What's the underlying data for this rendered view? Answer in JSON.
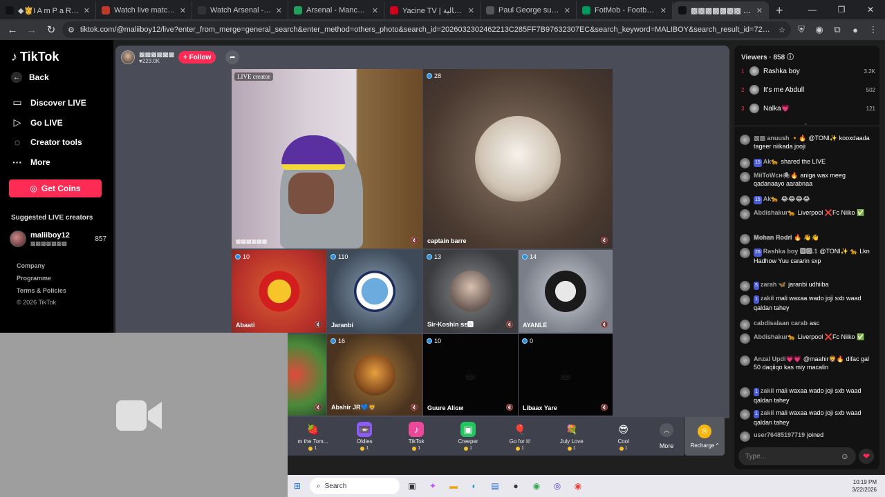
{
  "browser": {
    "tabs": [
      {
        "title": "◆👸I A m P a R D 💗🍓",
        "color": "#111111"
      },
      {
        "title": "Watch live matches — Ya",
        "color": "#c0392b"
      },
      {
        "title": "Watch Arsenal - Manches",
        "color": "#333333"
      },
      {
        "title": "Arsenal - Manchester City",
        "color": "#20a05a"
      },
      {
        "title": "Yacine TV | يقوم بجودة عالية",
        "color": "#d0021b"
      },
      {
        "title": "Paul George suspended fo",
        "color": "#555555"
      },
      {
        "title": "FotMob - Football Live Sc",
        "color": "#00985f"
      },
      {
        "title": "▩▩▩▩▩▩▩ (@mali",
        "color": "#111111"
      }
    ],
    "active_tab_index": 7,
    "new_tab_glyph": "+",
    "url": "tiktok.com/@maliiboy12/live?enter_from_merge=general_search&enter_method=others_photo&search_id=20260323024622​13C285FF7B97632307EC&search_keyword=MALIBOY&search_result_id=7275866381240248​38&search_type=general"
  },
  "sidebar": {
    "logo": "TikTok",
    "back": "Back",
    "items": [
      {
        "label": "Discover LIVE",
        "icon": "tv-icon"
      },
      {
        "label": "Go LIVE",
        "icon": "camera-icon"
      },
      {
        "label": "Creator tools",
        "icon": "lightbulb-icon"
      },
      {
        "label": "More",
        "icon": "more-icon"
      }
    ],
    "get_coins": "Get Coins",
    "suggested_title": "Suggested LIVE creators",
    "suggested": [
      {
        "name": "maliiboy12",
        "sub": "▩▩▩▩▩▩▩",
        "count": "857"
      }
    ],
    "footer": [
      "Company",
      "Programme",
      "Terms & Policies",
      "© 2026 TikTok"
    ]
  },
  "host": {
    "name": "▩▩▩▩▩▩",
    "likes": "♥223.0K",
    "follow": "+ Follow"
  },
  "tiles": {
    "main": {
      "tag": "LIVE creator",
      "name": "▩▩▩▩▩▩"
    },
    "guest": {
      "count": "28",
      "name": "captain barre"
    },
    "row1": [
      {
        "count": "10",
        "name": "Abaati"
      },
      {
        "count": "110",
        "name": "Jaranbi"
      },
      {
        "count": "13",
        "name": "Sir-Koshin ꜱᴇ🅰"
      },
      {
        "count": "14",
        "name": "AYANLE"
      }
    ],
    "row2": [
      {
        "count": "16",
        "name": "Abshir JR💙🦁"
      },
      {
        "count": "10",
        "name": "Guure Aliɢᴍ"
      },
      {
        "count": "0",
        "name": "Libaax Yare"
      }
    ]
  },
  "gifts": [
    {
      "name": "m the Tom...",
      "price": "1",
      "icon": "🍓",
      "color": "#3f424c"
    },
    {
      "name": "Oldies",
      "price": "1",
      "icon": "📼",
      "color": "#8b5cf6"
    },
    {
      "name": "TikTok",
      "price": "1",
      "icon": "♪",
      "color": "#ec4899"
    },
    {
      "name": "Creeper",
      "price": "1",
      "icon": "▣",
      "color": "#22c55e"
    },
    {
      "name": "Go for it!",
      "price": "1",
      "icon": "🎈",
      "color": "#3f424c"
    },
    {
      "name": "July Love",
      "price": "1",
      "icon": "💐",
      "color": "#3f424c"
    },
    {
      "name": "Cool",
      "price": "1",
      "icon": "😎",
      "color": "#3f424c"
    }
  ],
  "gift_more": "More",
  "recharge": "Recharge ^",
  "viewers": {
    "title": "Viewers · 858",
    "top": [
      {
        "rank": "1",
        "name": "Rashka boy",
        "count": "3.2K"
      },
      {
        "rank": "2",
        "name": "It's me Abdull",
        "count": "502"
      },
      {
        "rank": "3",
        "name": "Nalka💗",
        "count": "121"
      }
    ]
  },
  "chat": [
    {
      "level": "",
      "user": "▩▩ anuush 🔸🔥",
      "text": "@TONI✨ kooxdaada tageer niikada jooji"
    },
    {
      "level": "15",
      "user": "Ak🐆",
      "text": "shared the LIVE"
    },
    {
      "level": "",
      "user": "MiiToWᴄʜ🕷🔥",
      "text": "aniga wax meeg qadanaayo aarabnaa"
    },
    {
      "level": "15",
      "user": "Ak🐆",
      "text": "😂😂😂😂"
    },
    {
      "level": "",
      "user": "Abdishakur🐆",
      "text": "Liverpool ❌Fc Niiko ✅"
    },
    {
      "level": "",
      "user": "𝐌𝐨𝐡𝐚𝐧 𝐑𝐨𝐝𝐫𝐢 🔥",
      "text": "👋👋"
    },
    {
      "level": "26",
      "user": "Rashka boy 🅽🅾.1",
      "text": "@TONI✨ 🐆 Lkn Hadhow Yuu cararin sxp"
    },
    {
      "level": "5",
      "user": "zarah 🦋",
      "text": "jaranbi udhiiba"
    },
    {
      "level": "1",
      "user": "zakii",
      "text": "mali waxaa wado joji sxb waad qaldan tahey"
    },
    {
      "level": "",
      "user": "cabdisalaan carab",
      "text": "asc"
    },
    {
      "level": "",
      "user": "Abdishakur🐆",
      "text": "Liverpool ❌Fc Niiko ✅"
    },
    {
      "level": "",
      "user": "Anzal Updi💗💗",
      "text": "@maahir🦁🔥 difac gal 50 daqiiqo kas miy macalin"
    },
    {
      "level": "1",
      "user": "zakii",
      "text": "mali waxaa wado joji sxb waad qaldan tahey"
    },
    {
      "level": "1",
      "user": "zakii",
      "text": "mali waxaa wado joji sxb waad qaldan tahey"
    },
    {
      "level": "",
      "user": "user76485197719",
      "text": "joined"
    }
  ],
  "chat_input_placeholder": "Type...",
  "taskbar": {
    "search": "Search",
    "time": "10:19 PM",
    "date": "3/22/2026"
  }
}
